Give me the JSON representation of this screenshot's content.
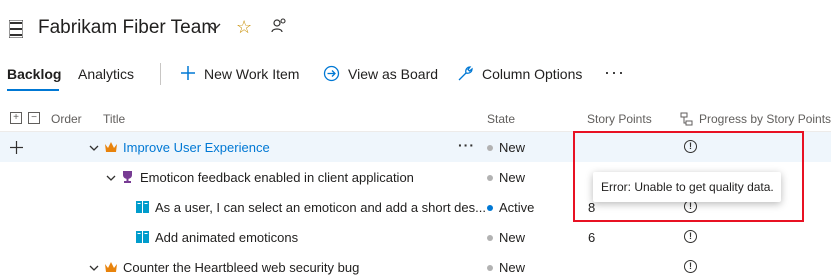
{
  "header": {
    "title": "Fabrikam Fiber Team"
  },
  "tabs": [
    {
      "label": "Backlog",
      "selected": true
    },
    {
      "label": "Analytics",
      "selected": false
    }
  ],
  "commands": {
    "new_work_item": "New Work Item",
    "view_as_board": "View as Board",
    "column_options": "Column Options",
    "more": "···"
  },
  "columns": {
    "order": "Order",
    "title": "Title",
    "state": "State",
    "story_points": "Story Points",
    "progress": "Progress by Story Points"
  },
  "rows": [
    {
      "title": "Improve User Experience",
      "state": "New",
      "story_points": "",
      "type": "feature",
      "level": 1
    },
    {
      "title": "Emoticon feedback enabled in client application",
      "state": "New",
      "story_points": "",
      "type": "epic",
      "level": 2
    },
    {
      "title": "As a user, I can select an emoticon and add a short des...",
      "state": "Active",
      "story_points": "8",
      "type": "story",
      "level": 3
    },
    {
      "title": "Add animated emoticons",
      "state": "New",
      "story_points": "6",
      "type": "story",
      "level": 3
    },
    {
      "title": "Counter the Heartbleed web security bug",
      "state": "New",
      "story_points": "",
      "type": "feature",
      "level": 1
    }
  ],
  "tooltip": {
    "text": "Error: Unable to get quality data."
  },
  "colors": {
    "accent": "#0078d4",
    "error_outline": "#e81123",
    "feature_icon": "#e8830c",
    "epic_icon": "#773b93"
  }
}
